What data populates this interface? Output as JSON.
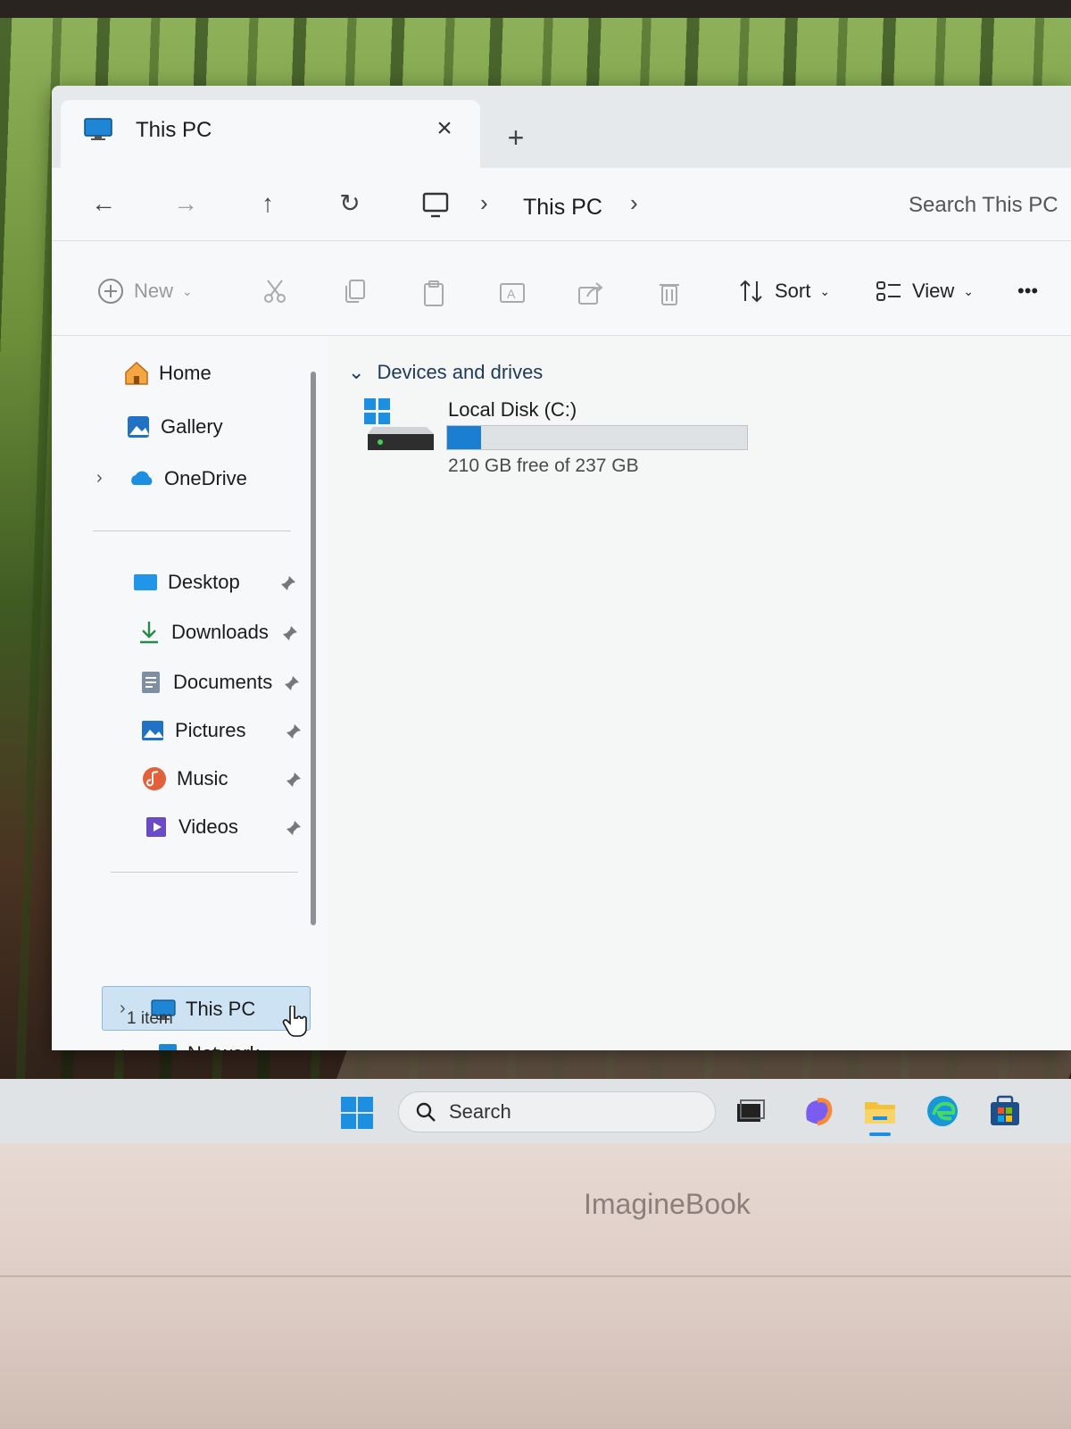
{
  "window": {
    "tab_title": "This PC",
    "tab_close": "×",
    "new_tab": "+"
  },
  "navigation": {
    "back": "←",
    "forward": "→",
    "up": "↑",
    "refresh": "↻",
    "separator": "›",
    "breadcrumb": [
      "This PC"
    ],
    "search_placeholder": "Search This PC"
  },
  "toolbar": {
    "new_label": "New",
    "sort_label": "Sort",
    "view_label": "View",
    "more_label": "•••",
    "icons": [
      "cut-icon",
      "copy-icon",
      "paste-icon",
      "rename-icon",
      "share-icon",
      "delete-icon"
    ]
  },
  "sidebar": {
    "top_items": [
      {
        "label": "Home",
        "icon": "home-icon"
      },
      {
        "label": "Gallery",
        "icon": "gallery-icon"
      },
      {
        "label": "OneDrive",
        "icon": "onedrive-icon"
      }
    ],
    "pinned_items": [
      {
        "label": "Desktop",
        "icon": "desktop-icon"
      },
      {
        "label": "Downloads",
        "icon": "downloads-icon"
      },
      {
        "label": "Documents",
        "icon": "documents-icon"
      },
      {
        "label": "Pictures",
        "icon": "pictures-icon"
      },
      {
        "label": "Music",
        "icon": "music-icon"
      },
      {
        "label": "Videos",
        "icon": "videos-icon"
      }
    ],
    "bottom_items": [
      {
        "label": "This PC",
        "icon": "monitor-icon",
        "selected": true
      },
      {
        "label": "Network",
        "icon": "network-icon"
      }
    ]
  },
  "content": {
    "group_header": "Devices and drives",
    "drives": [
      {
        "name": "Local Disk (C:)",
        "free_text": "210 GB free of 237 GB",
        "used_fraction": 0.114
      }
    ]
  },
  "status_bar": {
    "item_count": "1 item"
  },
  "taskbar": {
    "search_label": "Search",
    "apps": [
      "task-view-icon",
      "copilot-icon",
      "file-explorer-icon",
      "edge-icon",
      "store-icon"
    ]
  },
  "device": {
    "brand": "ImagineBook"
  },
  "colors": {
    "accent": "#1a7fd0",
    "selection": "#cde3f3"
  }
}
